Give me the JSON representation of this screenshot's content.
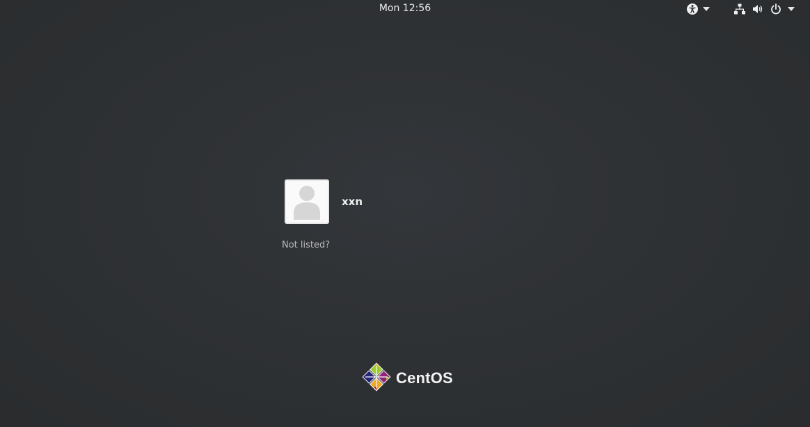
{
  "topbar": {
    "clock": "Mon 12:56",
    "icons": {
      "accessibility": "accessibility-icon",
      "accessibility_menu": "chevron-down-icon",
      "network": "network-wired-icon",
      "volume": "volume-icon",
      "power": "power-icon",
      "system_menu": "chevron-down-icon"
    }
  },
  "login": {
    "users": [
      {
        "name": "xxn",
        "avatar": "user-silhouette-icon"
      }
    ],
    "not_listed": "Not listed?"
  },
  "branding": {
    "logo": "centos-logo",
    "text": "CentOS"
  },
  "colors": {
    "background": "#2e3032",
    "text": "#eeeeee",
    "muted_text": "#b9b9b9"
  }
}
